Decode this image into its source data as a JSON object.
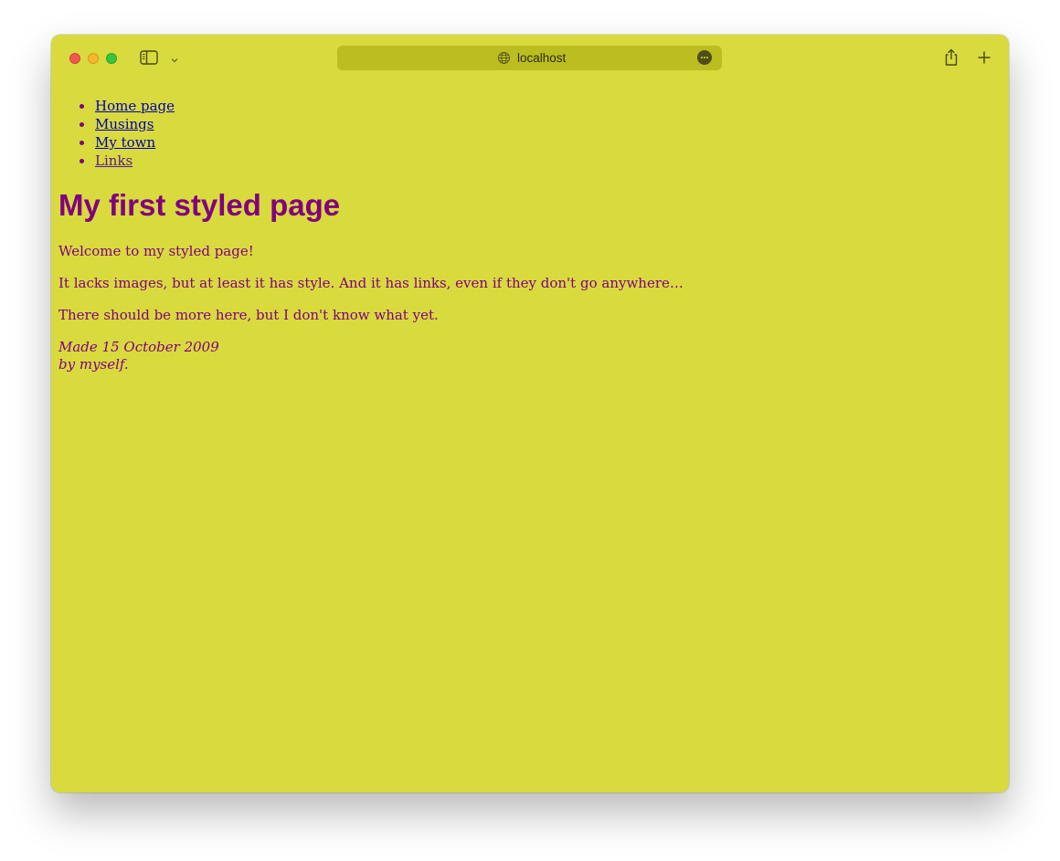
{
  "browser": {
    "url": "localhost"
  },
  "page": {
    "nav": [
      {
        "label": "Home page"
      },
      {
        "label": "Musings"
      },
      {
        "label": "My town"
      },
      {
        "label": "Links"
      }
    ],
    "title": "My first styled page",
    "paragraphs": [
      "Welcome to my styled page!",
      "It lacks images, but at least it has style. And it has links, even if they don't go anywhere…",
      "There should be more here, but I don't know what yet."
    ],
    "address": {
      "line1": "Made 15 October 2009",
      "line2": "by myself."
    }
  },
  "colors": {
    "page_background": "#d9da3e",
    "text": "#800080",
    "link": "#0000b0",
    "visited_link": "#551a8b",
    "address_bar": "#bcbd20"
  },
  "icons": [
    "close-button",
    "minimize-button",
    "zoom-button",
    "sidebar-icon",
    "chevron-down-icon",
    "globe-icon",
    "more-icon",
    "share-icon",
    "plus-icon"
  ]
}
